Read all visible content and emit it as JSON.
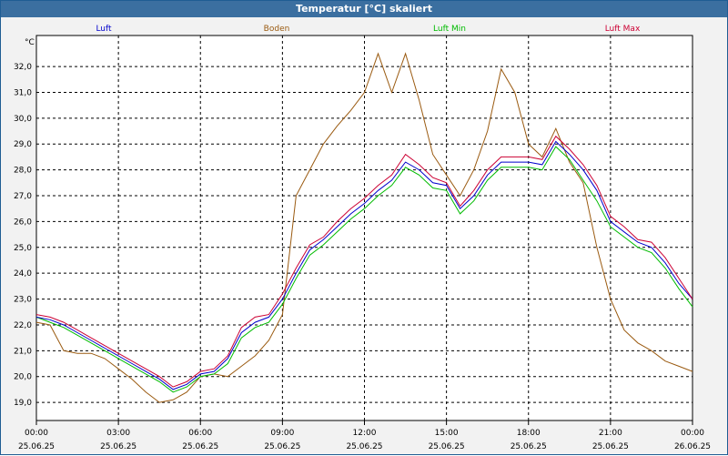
{
  "chart_data": {
    "type": "line",
    "title": "Temperatur [°C] skaliert",
    "ylabel": "°C",
    "ylim": [
      18.3,
      33.2
    ],
    "yticks": [
      "19,0",
      "20,0",
      "21,0",
      "22,0",
      "23,0",
      "24,0",
      "25,0",
      "26,0",
      "27,0",
      "28,0",
      "29,0",
      "30,0",
      "31,0",
      "32,0"
    ],
    "ytick_values": [
      19,
      20,
      21,
      22,
      23,
      24,
      25,
      26,
      27,
      28,
      29,
      30,
      31,
      32
    ],
    "xlim": [
      "2025-06-25T00:00",
      "2025-06-26T00:00"
    ],
    "xticks": [
      {
        "time": "00:00",
        "date": "25.06.25"
      },
      {
        "time": "03:00",
        "date": "25.06.25"
      },
      {
        "time": "06:00",
        "date": "25.06.25"
      },
      {
        "time": "09:00",
        "date": "25.06.25"
      },
      {
        "time": "12:00",
        "date": "25.06.25"
      },
      {
        "time": "15:00",
        "date": "25.06.25"
      },
      {
        "time": "18:00",
        "date": "25.06.25"
      },
      {
        "time": "21:00",
        "date": "25.06.25"
      },
      {
        "time": "00:00",
        "date": "26.06.25"
      }
    ],
    "x_hours": [
      0,
      0.5,
      1,
      1.5,
      2,
      2.5,
      3,
      3.5,
      4,
      4.5,
      5,
      5.5,
      6,
      6.5,
      7,
      7.5,
      8,
      8.5,
      9,
      9.5,
      10,
      10.5,
      11,
      11.5,
      12,
      12.5,
      13,
      13.5,
      14,
      14.5,
      15,
      15.5,
      16,
      16.5,
      17,
      17.5,
      18,
      18.5,
      19,
      19.5,
      20,
      20.5,
      21,
      21.5,
      22,
      22.5,
      23,
      23.5,
      24
    ],
    "series": [
      {
        "name": "Luft",
        "color": "#0000cc",
        "values": [
          22.3,
          22.2,
          22.0,
          21.7,
          21.4,
          21.1,
          20.8,
          20.5,
          20.2,
          19.9,
          19.5,
          19.7,
          20.1,
          20.2,
          20.7,
          21.7,
          22.1,
          22.3,
          23.0,
          24.0,
          24.9,
          25.3,
          25.8,
          26.3,
          26.7,
          27.2,
          27.6,
          28.3,
          28.0,
          27.5,
          27.4,
          26.5,
          27.0,
          27.8,
          28.3,
          28.3,
          28.3,
          28.2,
          29.1,
          28.6,
          28.0,
          27.2,
          26.0,
          25.6,
          25.2,
          25.0,
          24.4,
          23.6,
          23.0
        ]
      },
      {
        "name": "Boden",
        "color": "#9a5a10",
        "values": [
          22.1,
          22.0,
          21.0,
          20.9,
          20.9,
          20.7,
          20.3,
          19.9,
          19.4,
          19.0,
          19.1,
          19.4,
          20.0,
          20.1,
          20.0,
          20.4,
          20.8,
          21.4,
          22.4,
          27.0,
          28.0,
          29.0,
          29.7,
          30.3,
          31.0,
          32.5,
          31.0,
          32.5,
          30.7,
          28.6,
          27.8,
          27.0,
          28.0,
          29.5,
          31.9,
          31.0,
          29.0,
          28.5,
          29.6,
          28.3,
          27.5,
          25.0,
          23.0,
          21.8,
          21.3,
          21.0,
          20.6,
          20.4,
          20.2
        ]
      },
      {
        "name": "Luft Min",
        "color": "#00bb00",
        "values": [
          22.3,
          22.1,
          21.9,
          21.6,
          21.3,
          21.0,
          20.7,
          20.4,
          20.1,
          19.8,
          19.4,
          19.6,
          20.0,
          20.1,
          20.5,
          21.5,
          21.9,
          22.1,
          22.8,
          23.8,
          24.7,
          25.1,
          25.6,
          26.1,
          26.5,
          27.0,
          27.4,
          28.1,
          27.8,
          27.3,
          27.2,
          26.3,
          26.8,
          27.6,
          28.1,
          28.1,
          28.1,
          28.0,
          28.9,
          28.4,
          27.6,
          26.8,
          25.8,
          25.4,
          25.0,
          24.8,
          24.2,
          23.4,
          22.7
        ]
      },
      {
        "name": "Luft Max",
        "color": "#cc0033",
        "values": [
          22.4,
          22.3,
          22.1,
          21.8,
          21.5,
          21.2,
          20.9,
          20.6,
          20.3,
          20.0,
          19.6,
          19.8,
          20.2,
          20.3,
          20.8,
          21.9,
          22.3,
          22.4,
          23.2,
          24.2,
          25.1,
          25.4,
          26.0,
          26.5,
          26.9,
          27.4,
          27.8,
          28.6,
          28.2,
          27.7,
          27.5,
          26.6,
          27.2,
          28.0,
          28.5,
          28.5,
          28.5,
          28.4,
          29.3,
          28.8,
          28.2,
          27.4,
          26.2,
          25.8,
          25.3,
          25.2,
          24.6,
          23.8,
          23.0
        ]
      }
    ],
    "grid": true,
    "legend": "top"
  }
}
